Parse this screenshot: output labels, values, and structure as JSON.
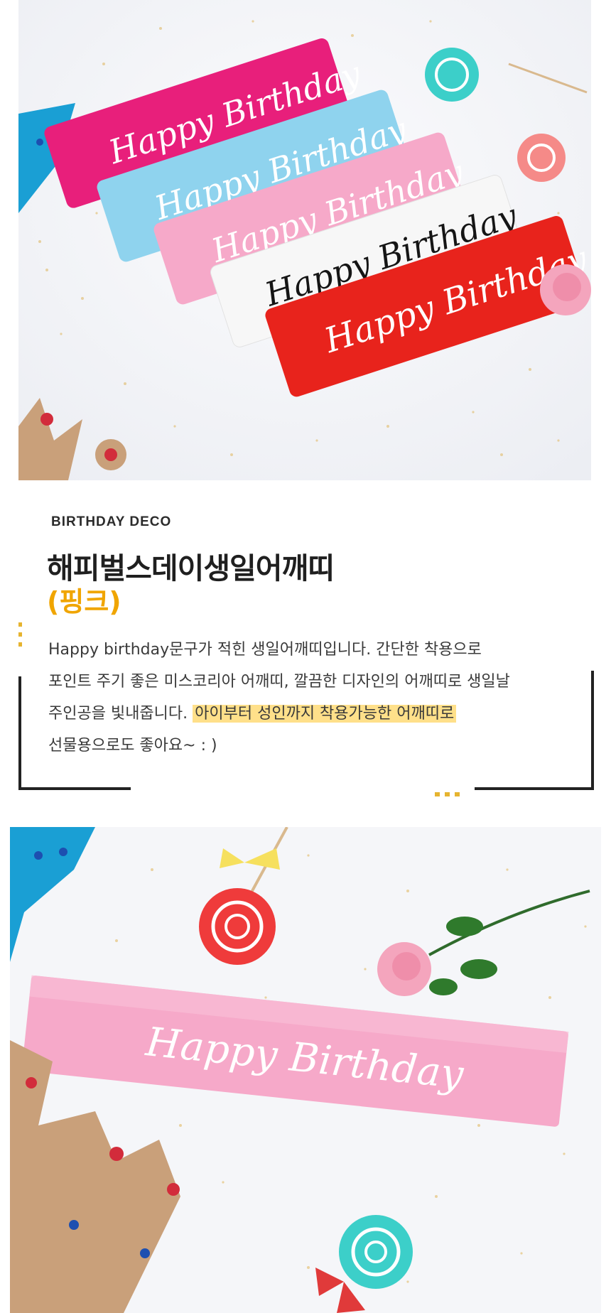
{
  "product": {
    "eyebrow": "BIRTHDAY DECO",
    "title": "해피벌스데이생일어깨띠",
    "subtitle": "(핑크)",
    "description": {
      "line1": "Happy birthday문구가 적힌 생일어깨띠입니다. 간단한 착용으로",
      "line2": "포인트 주기 좋은 미스코리아 어깨띠, 깔끔한 디자인의 어깨띠로 생일날",
      "line3_plain": "주인공을 빛내줍니다. ",
      "line3_highlight": "아이부터 성인까지 착용가능한 어깨띠로",
      "line4": "선물용으로도 좋아요~ : )"
    }
  },
  "images": {
    "top_sash_text": [
      "Happy Birthday",
      "Happy Birthday",
      "Happy Birthday",
      "Happy Birthday",
      "Happy Birthday"
    ],
    "bottom_sash_text": "Happy Birthday"
  },
  "colors": {
    "accent_yellow": "#f0a500",
    "highlight": "#ffe08a",
    "sash_magenta": "#e81f7b",
    "sash_skyblue": "#8fd3ee",
    "sash_pink": "#f6a9c9",
    "sash_white": "#f7f7f7",
    "sash_red": "#e8231c"
  }
}
